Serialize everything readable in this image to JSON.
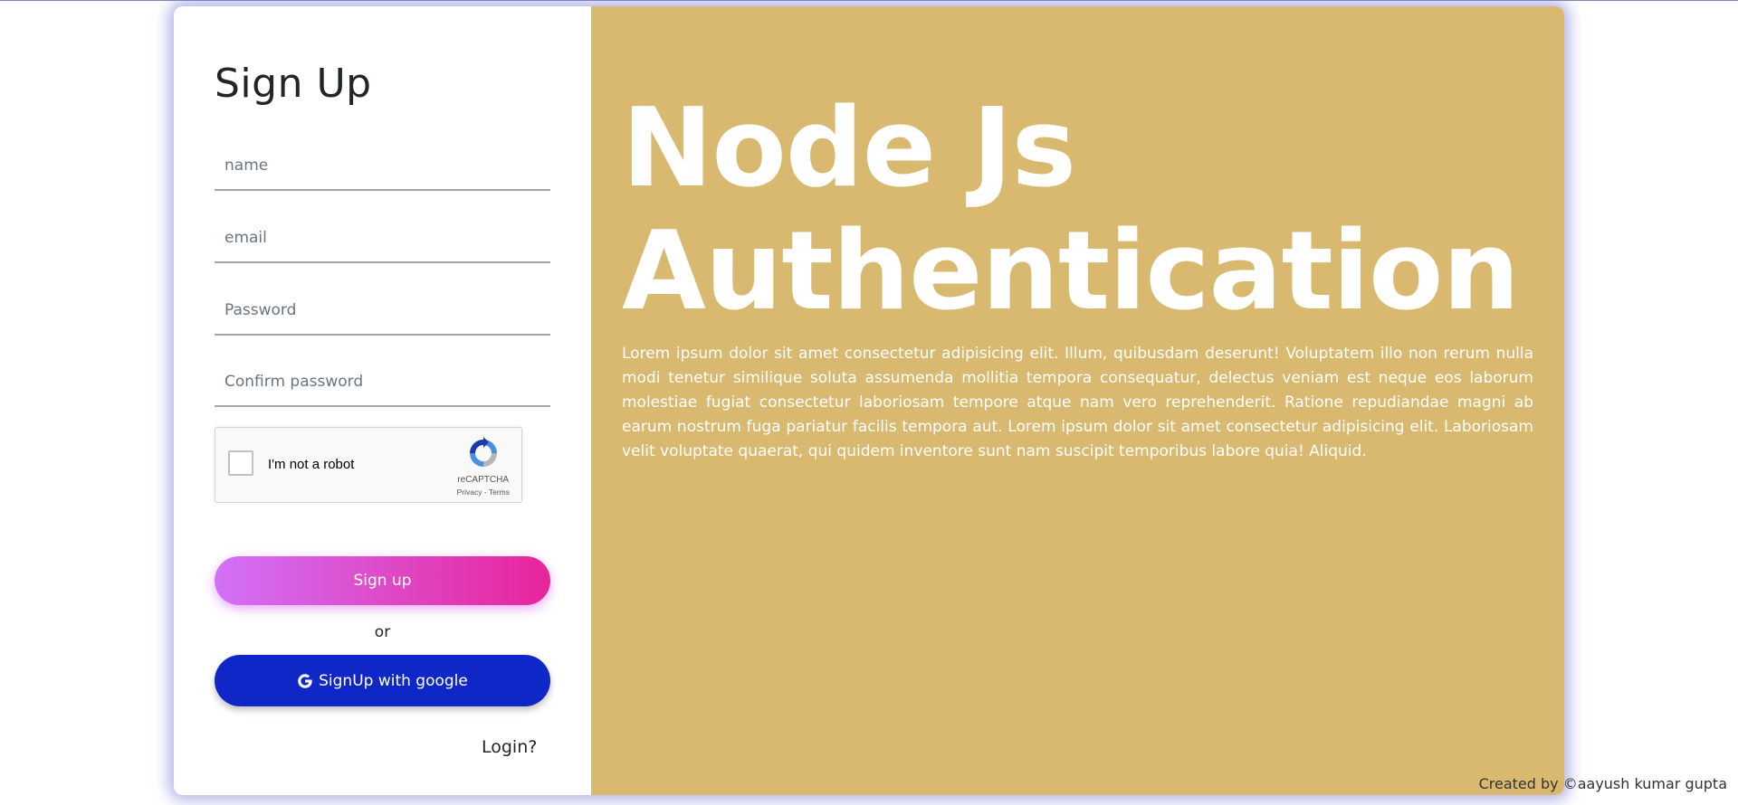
{
  "form": {
    "title": "Sign Up",
    "fields": [
      {
        "placeholder": "name",
        "value": ""
      },
      {
        "placeholder": "email",
        "value": ""
      },
      {
        "placeholder": "Password",
        "value": ""
      },
      {
        "placeholder": "Confirm password",
        "value": ""
      }
    ],
    "recaptcha": {
      "label": "I'm not a robot",
      "brand": "reCAPTCHA",
      "links": "Privacy - Terms"
    },
    "signup_label": "Sign up",
    "or_text": "or",
    "google_label": "SignUp with google",
    "login_link": "Login?"
  },
  "hero": {
    "line1": "Node Js",
    "line2": "Authentication",
    "description": "Lorem ipsum dolor sit amet consectetur adipisicing elit. Illum, quibusdam deserunt! Voluptatem illo non rerum nulla modi tenetur similique soluta assumenda mollitia tempora consequatur, delectus veniam est neque eos laborum molestiae fugiat consectetur laboriosam tempore atque nam vero reprehenderit. Ratione repudiandae magni ab earum nostrum fuga pariatur facilis tempora aut. Lorem ipsum dolor sit amet consectetur adipisicing elit. Laboriosam velit voluptate quaerat, qui quidem inventore sunt nam suscipit temporibus labore quia! Aliquid."
  },
  "footer": {
    "credit": "Created by ©aayush kumar gupta"
  },
  "colors": {
    "panel_right": "#d9b96f",
    "signup_gradient_start": "#d271f7",
    "signup_gradient_end": "#e8249a",
    "google_button": "#1027c7"
  },
  "icons": {
    "recaptcha": "recaptcha-logo-icon",
    "google": "google-g-icon"
  }
}
